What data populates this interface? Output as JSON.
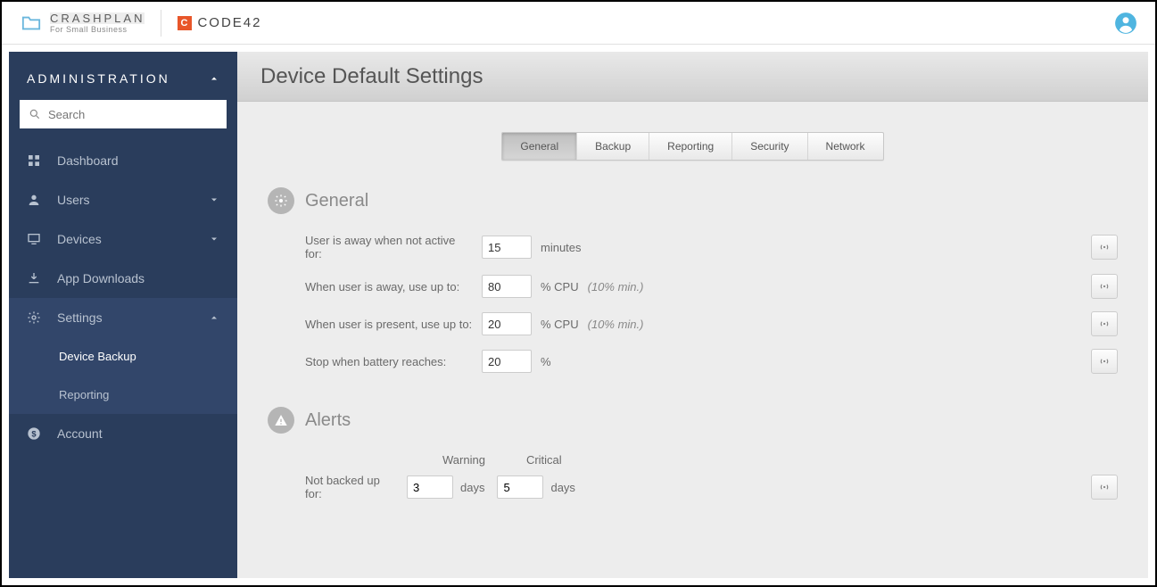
{
  "header": {
    "brand_main": "CRASHPLAN",
    "brand_sub": "For Small Business",
    "partner": "CODE42"
  },
  "sidebar": {
    "title": "ADMINISTRATION",
    "search_placeholder": "Search",
    "items": {
      "dashboard": "Dashboard",
      "users": "Users",
      "devices": "Devices",
      "app_downloads": "App Downloads",
      "settings": "Settings",
      "account": "Account"
    },
    "settings_sub": {
      "device_backup": "Device Backup",
      "reporting": "Reporting"
    }
  },
  "page": {
    "title": "Device Default Settings"
  },
  "tabs": {
    "general": "General",
    "backup": "Backup",
    "reporting": "Reporting",
    "security": "Security",
    "network": "Network"
  },
  "general": {
    "heading": "General",
    "rows": {
      "away_label": "User is away when not active for:",
      "away_value": "15",
      "away_suffix": "minutes",
      "cpu_away_label": "When user is away, use up to:",
      "cpu_away_value": "80",
      "cpu_away_suffix": "% CPU",
      "cpu_away_hint": "(10% min.)",
      "cpu_present_label": "When user is present, use up to:",
      "cpu_present_value": "20",
      "cpu_present_suffix": "% CPU",
      "cpu_present_hint": "(10% min.)",
      "battery_label": "Stop when battery reaches:",
      "battery_value": "20",
      "battery_suffix": "%"
    }
  },
  "alerts": {
    "heading": "Alerts",
    "warning_header": "Warning",
    "critical_header": "Critical",
    "not_backed_label": "Not backed up for:",
    "warning_value": "3",
    "warning_suffix": "days",
    "critical_value": "5",
    "critical_suffix": "days"
  }
}
